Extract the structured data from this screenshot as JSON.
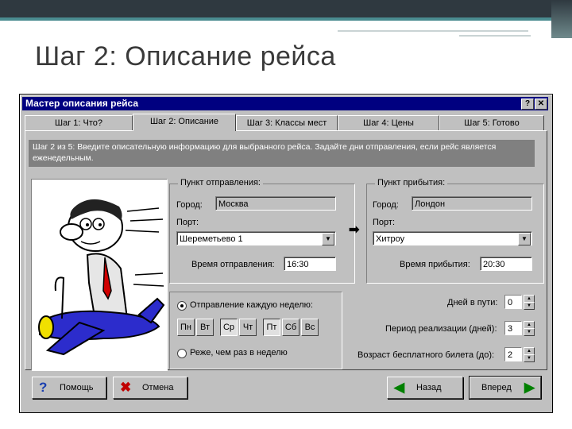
{
  "slide": {
    "title": "Шаг 2: Описание рейса"
  },
  "dialog": {
    "title": "Мастер описания рейса",
    "help_btn": "?",
    "close_btn": "✕",
    "tabs": [
      {
        "label": "Шаг 1: Что?"
      },
      {
        "label": "Шаг 2: Описание"
      },
      {
        "label": "Шаг 3: Классы мест"
      },
      {
        "label": "Шаг 4: Цены"
      },
      {
        "label": "Шаг 5: Готово"
      }
    ],
    "info_text": "Шаг 2 из 5: Введите описательную информацию для выбранного рейса. Задайте дни отправления, если рейс является еженедельным.",
    "departure": {
      "group_label": "Пункт отправления:",
      "city_label": "Город:",
      "city_value": "Москва",
      "port_label": "Порт:",
      "port_value": "Шереметьево 1",
      "time_label": "Время отправления:",
      "time_value": "16:30"
    },
    "arrival": {
      "group_label": "Пункт прибытия:",
      "city_label": "Город:",
      "city_value": "Лондон",
      "port_label": "Порт:",
      "port_value": "Хитроу",
      "time_label": "Время прибытия:",
      "time_value": "20:30"
    },
    "schedule": {
      "weekly_label": "Отправление каждую неделю:",
      "days": [
        "Пн",
        "Вт",
        "Ср",
        "Чт",
        "Пт",
        "Сб",
        "Вс"
      ],
      "selected_days": [
        "Ср",
        "Пт"
      ],
      "rare_label": "Реже, чем раз в неделю"
    },
    "days_in_transit": {
      "label": "Дней в пути:",
      "value": "0"
    },
    "sale_period": {
      "label": "Период реализации (дней):",
      "value": "3"
    },
    "free_ticket_age": {
      "label": "Возраст бесплатного билета (до):",
      "value": "2"
    },
    "buttons": {
      "help": "Помощь",
      "cancel": "Отмена",
      "back": "Назад",
      "next": "Вперед"
    },
    "colors": {
      "titlebar": "#000080",
      "face": "#c0c0c0",
      "info_bg": "#808080",
      "help_icon": "#1a3fb0",
      "cancel_icon": "#c00000",
      "nav_icon": "#008000"
    }
  }
}
